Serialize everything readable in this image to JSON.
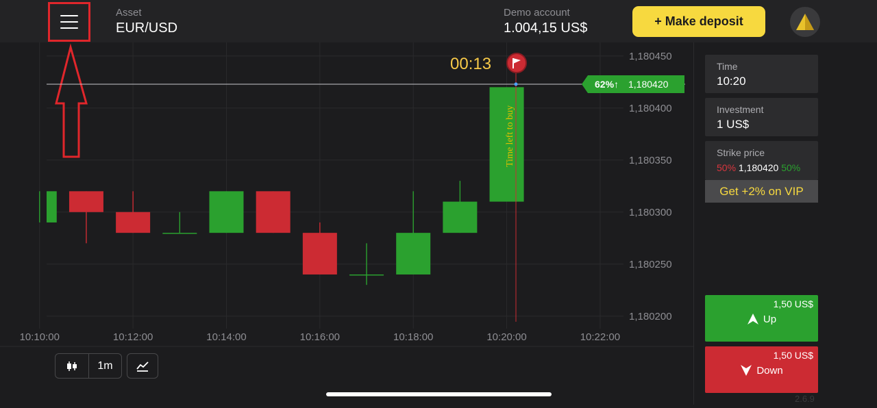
{
  "header": {
    "asset_label": "Asset",
    "asset_value": "EUR/USD",
    "account_label": "Demo account",
    "account_value": "1.004,15 US$",
    "deposit_label": "+ Make deposit"
  },
  "chart": {
    "timer": "00:13",
    "vertical_label": "Time left to buy",
    "price_badge": {
      "percent": "62%↑",
      "price": "1,180420"
    },
    "y_ticks": [
      "1,180450",
      "1,180400",
      "1,180350",
      "1,180300",
      "1,180250",
      "1,180200"
    ],
    "x_ticks": [
      "10:10:00",
      "10:12:00",
      "10:14:00",
      "10:16:00",
      "10:18:00",
      "10:20:00",
      "10:22:00"
    ],
    "colors": {
      "up": "#2ba12f",
      "down": "#cc2b33",
      "bg": "#1c1c1e",
      "grid": "#2a2a2c",
      "axis_text": "#8e8e93"
    }
  },
  "chart_data": {
    "type": "candlestick",
    "ylim": [
      1.180188,
      1.180463
    ],
    "xlim_minutes": [
      10.15,
      22.5
    ],
    "y_ticks": [
      1.18045,
      1.1804,
      1.18035,
      1.1803,
      1.18025,
      1.1802
    ],
    "x_ticks": [
      "10:10:00",
      "10:12:00",
      "10:14:00",
      "10:16:00",
      "10:18:00",
      "10:20:00",
      "10:22:00"
    ],
    "current_price": 1.18042,
    "candles": [
      {
        "t": 10.0,
        "open": 1.18029,
        "close": 1.18032,
        "high": 1.18032,
        "low": 1.18029
      },
      {
        "t": 11.0,
        "open": 1.18032,
        "close": 1.1803,
        "high": 1.18032,
        "low": 1.18027
      },
      {
        "t": 12.0,
        "open": 1.1803,
        "close": 1.18028,
        "high": 1.18032,
        "low": 1.18028
      },
      {
        "t": 13.0,
        "open": 1.18028,
        "close": 1.18028,
        "high": 1.1803,
        "low": 1.18028
      },
      {
        "t": 14.0,
        "open": 1.18028,
        "close": 1.18032,
        "high": 1.18032,
        "low": 1.18028
      },
      {
        "t": 15.0,
        "open": 1.18032,
        "close": 1.18028,
        "high": 1.18032,
        "low": 1.18028
      },
      {
        "t": 16.0,
        "open": 1.18028,
        "close": 1.18024,
        "high": 1.18029,
        "low": 1.18024
      },
      {
        "t": 17.0,
        "open": 1.18024,
        "close": 1.18024,
        "high": 1.18027,
        "low": 1.18023
      },
      {
        "t": 18.0,
        "open": 1.18024,
        "close": 1.18028,
        "high": 1.18032,
        "low": 1.18024
      },
      {
        "t": 19.0,
        "open": 1.18028,
        "close": 1.18031,
        "high": 1.18033,
        "low": 1.18028
      },
      {
        "t": 20.0,
        "open": 1.18031,
        "close": 1.18042,
        "high": 1.18042,
        "low": 1.18031
      }
    ]
  },
  "tools": {
    "timeframe": "1m",
    "candles_icon": "candlestick-icon",
    "indicators_icon": "indicators-icon"
  },
  "panel": {
    "time_label": "Time",
    "time_value": "10:20",
    "investment_label": "Investment",
    "investment_value": "1 US$",
    "strike_label": "Strike price",
    "strike_left": "50%",
    "strike_value": "1,180420",
    "strike_right": "50%",
    "vip": "Get +2% on VIP",
    "up_amount": "1,50 US$",
    "up_label": "Up",
    "down_amount": "1,50 US$",
    "down_label": "Down",
    "version": "2.6.9"
  }
}
